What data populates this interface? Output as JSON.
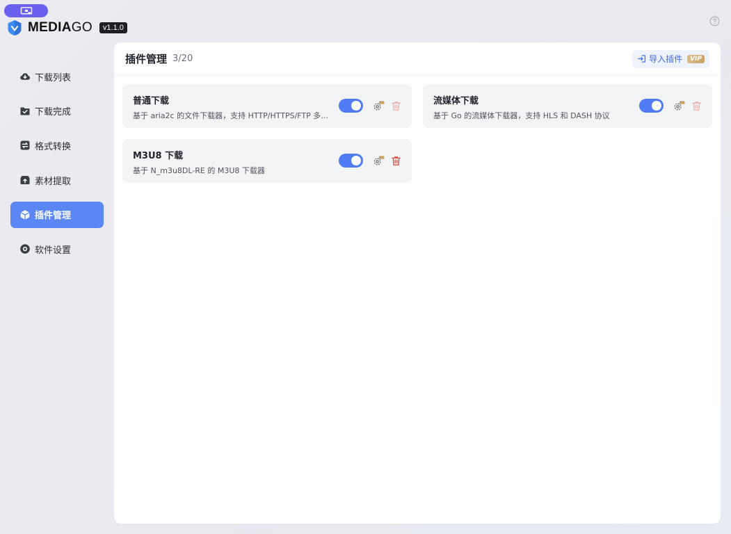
{
  "app": {
    "name_bold": "MEDIA",
    "name_light": "GO",
    "version": "v1.1.0"
  },
  "sidebar": {
    "items": [
      {
        "label": "下载列表",
        "icon": "cloud-download-icon",
        "active": false
      },
      {
        "label": "下载完成",
        "icon": "folder-check-icon",
        "active": false
      },
      {
        "label": "格式转换",
        "icon": "convert-icon",
        "active": false
      },
      {
        "label": "素材提取",
        "icon": "box-upload-icon",
        "active": false
      },
      {
        "label": "插件管理",
        "icon": "plugin-cube-icon",
        "active": true
      },
      {
        "label": "软件设置",
        "icon": "settings-icon",
        "active": false
      }
    ]
  },
  "main": {
    "title": "插件管理",
    "count": "3/20",
    "import_label": "导入插件",
    "vip_label": "VIP"
  },
  "plugins": [
    {
      "name": "普通下载",
      "desc": "基于 aria2c 的文件下载器，支持 HTTP/HTTPS/FTP 多…",
      "enabled": true,
      "deletable": false
    },
    {
      "name": "流媒体下载",
      "desc": "基于 Go 的流媒体下载器，支持 HLS 和 DASH 协议",
      "enabled": true,
      "deletable": false
    },
    {
      "name": "M3U8 下载",
      "desc": "基于 N_m3u8DL-RE 的 M3U8 下载器",
      "enabled": true,
      "deletable": true
    }
  ],
  "colors": {
    "accent": "#5b87f5",
    "toggle_on": "#4f7cf4",
    "delete_enabled": "#e0483e",
    "delete_disabled": "#f0a8a3",
    "vip_gold": "#c9a264"
  }
}
